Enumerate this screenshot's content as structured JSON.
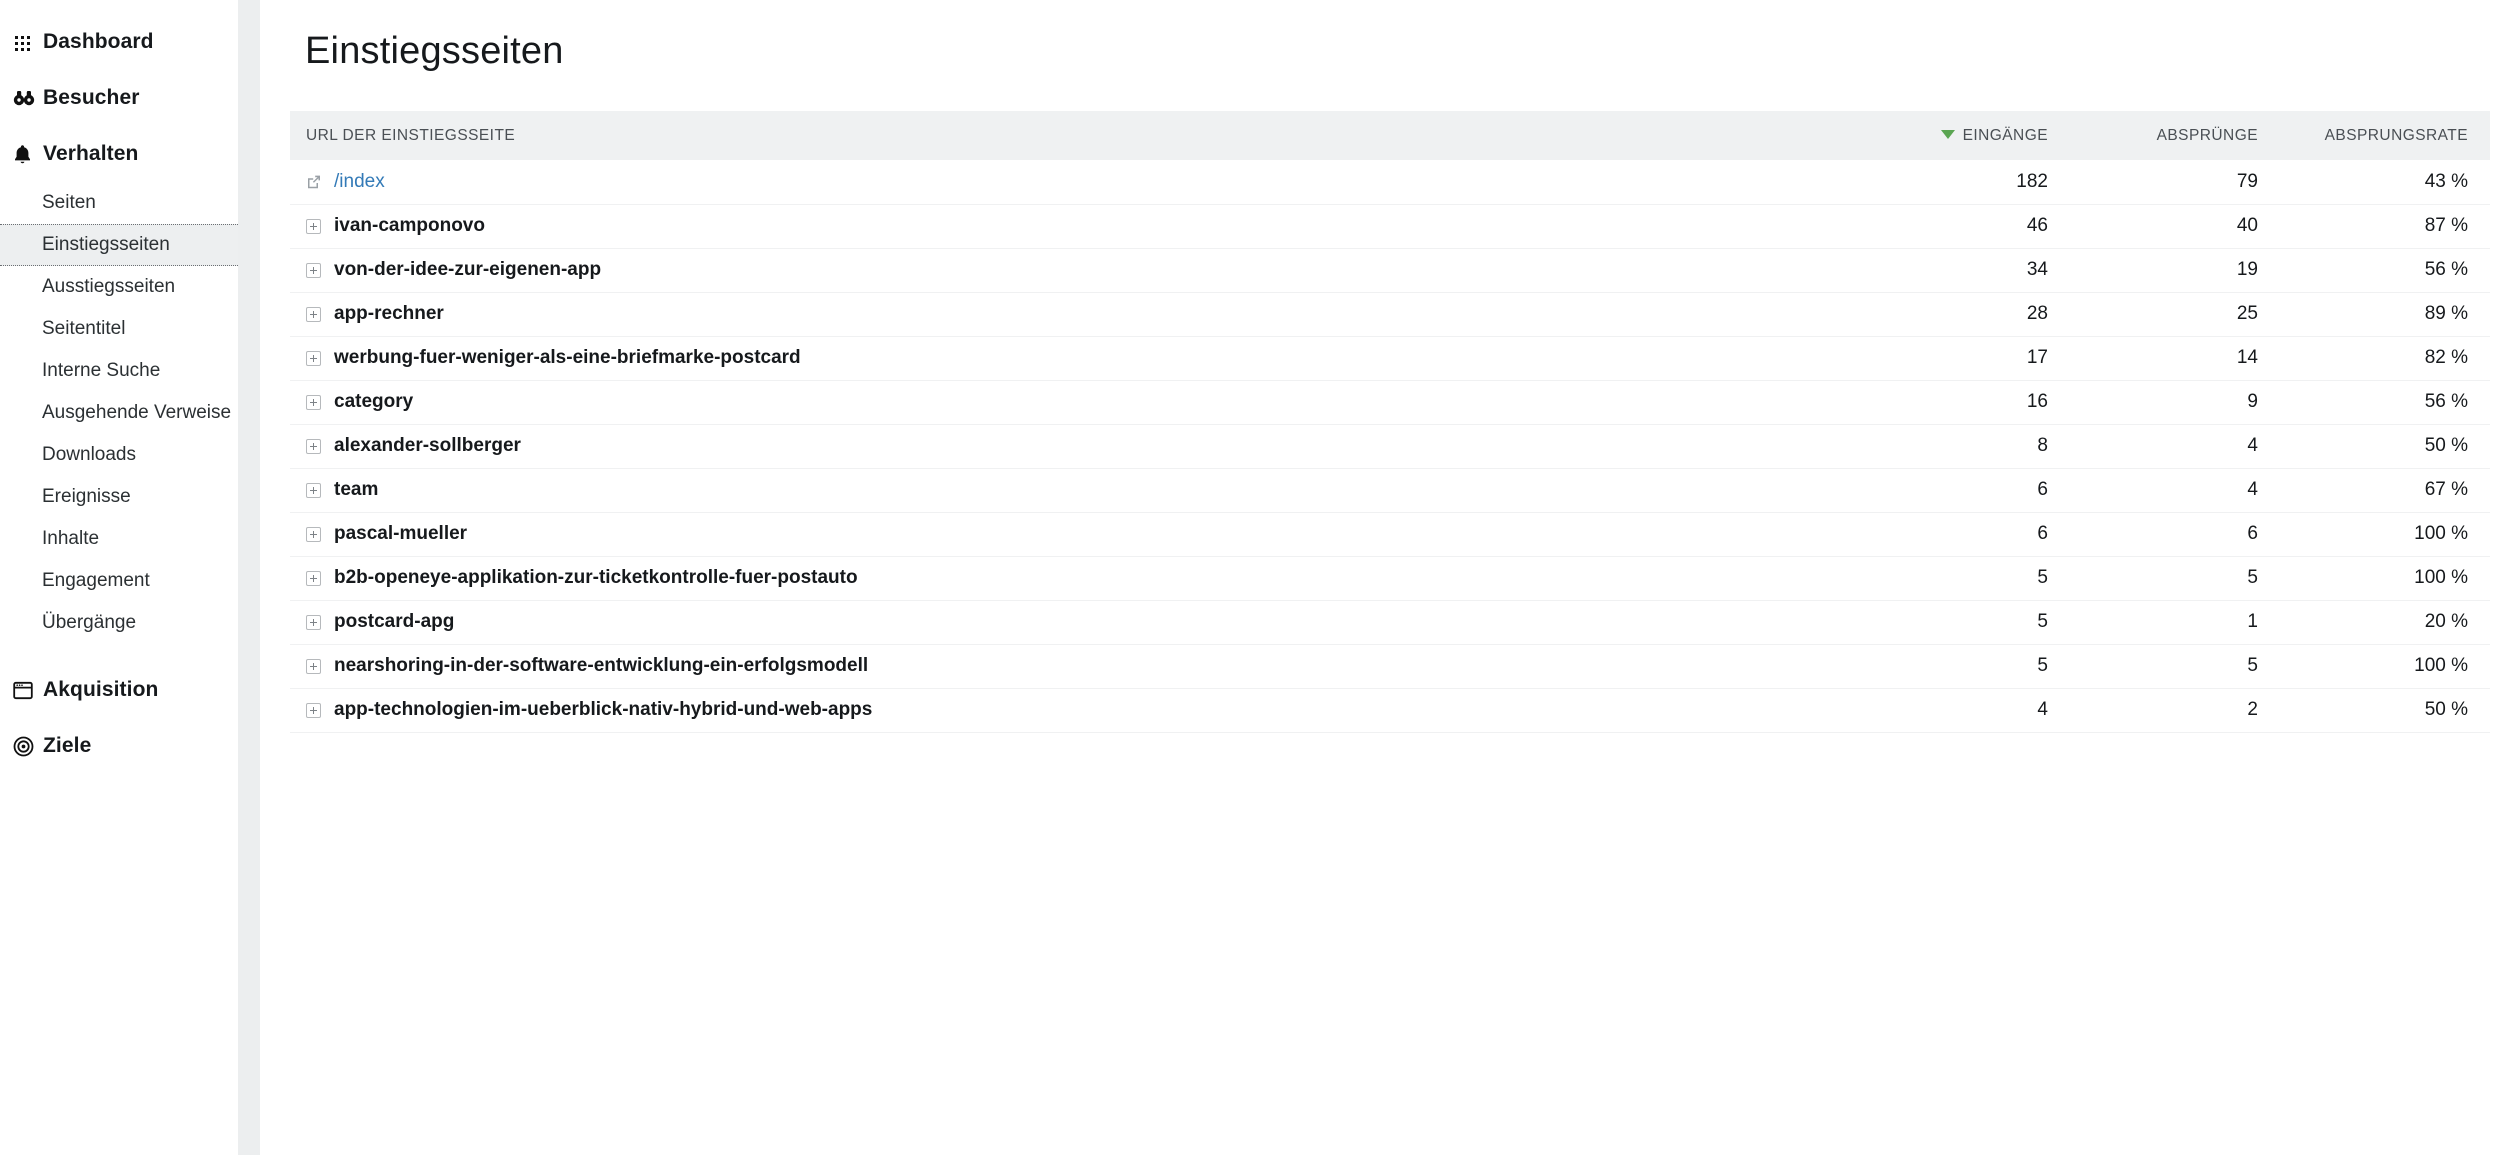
{
  "sidebar": {
    "items": [
      {
        "label": "Dashboard",
        "icon": "grid-icon",
        "level": "top",
        "active": false
      },
      {
        "label": "Besucher",
        "icon": "binoculars-icon",
        "level": "top",
        "active": false
      },
      {
        "label": "Verhalten",
        "icon": "bell-icon",
        "level": "top",
        "active": false
      },
      {
        "label": "Seiten",
        "icon": "",
        "level": "sub",
        "active": false
      },
      {
        "label": "Einstiegsseiten",
        "icon": "",
        "level": "sub",
        "active": true
      },
      {
        "label": "Ausstiegsseiten",
        "icon": "",
        "level": "sub",
        "active": false
      },
      {
        "label": "Seitentitel",
        "icon": "",
        "level": "sub",
        "active": false
      },
      {
        "label": "Interne Suche",
        "icon": "",
        "level": "sub",
        "active": false
      },
      {
        "label": "Ausgehende Verweise",
        "icon": "",
        "level": "sub",
        "active": false
      },
      {
        "label": "Downloads",
        "icon": "",
        "level": "sub",
        "active": false
      },
      {
        "label": "Ereignisse",
        "icon": "",
        "level": "sub",
        "active": false
      },
      {
        "label": "Inhalte",
        "icon": "",
        "level": "sub",
        "active": false
      },
      {
        "label": "Engagement",
        "icon": "",
        "level": "sub",
        "active": false
      },
      {
        "label": "Übergänge",
        "icon": "",
        "level": "sub",
        "active": false
      },
      {
        "label": "Akquisition",
        "icon": "window-icon",
        "level": "top",
        "active": false
      },
      {
        "label": "Ziele",
        "icon": "target-icon",
        "level": "top",
        "active": false
      }
    ]
  },
  "main": {
    "title": "Einstiegsseiten",
    "table": {
      "columns": [
        {
          "key": "url",
          "label": "URL DER EINSTIEGSSEITE",
          "align": "left",
          "sorted": false
        },
        {
          "key": "entries",
          "label": "EINGÄNGE",
          "align": "right",
          "sorted": true,
          "sort_dir": "desc"
        },
        {
          "key": "bounces",
          "label": "ABSPRÜNGE",
          "align": "right",
          "sorted": false
        },
        {
          "key": "bounce_rate",
          "label": "ABSPRUNGSRATE",
          "align": "right",
          "sorted": false
        }
      ],
      "sort_arrow_color": "#5aa552",
      "link_color": "#337ab7",
      "rows": [
        {
          "url": "/index",
          "icon": "external-link-icon",
          "is_link": true,
          "entries": "182",
          "bounces": "79",
          "bounce_rate": "43 %"
        },
        {
          "url": "ivan-camponovo",
          "icon": "expand-plus-icon",
          "is_link": false,
          "entries": "46",
          "bounces": "40",
          "bounce_rate": "87 %"
        },
        {
          "url": "von-der-idee-zur-eigenen-app",
          "icon": "expand-plus-icon",
          "is_link": false,
          "entries": "34",
          "bounces": "19",
          "bounce_rate": "56 %"
        },
        {
          "url": "app-rechner",
          "icon": "expand-plus-icon",
          "is_link": false,
          "entries": "28",
          "bounces": "25",
          "bounce_rate": "89 %"
        },
        {
          "url": "werbung-fuer-weniger-als-eine-briefmarke-postcard",
          "icon": "expand-plus-icon",
          "is_link": false,
          "entries": "17",
          "bounces": "14",
          "bounce_rate": "82 %"
        },
        {
          "url": "category",
          "icon": "expand-plus-icon",
          "is_link": false,
          "entries": "16",
          "bounces": "9",
          "bounce_rate": "56 %"
        },
        {
          "url": "alexander-sollberger",
          "icon": "expand-plus-icon",
          "is_link": false,
          "entries": "8",
          "bounces": "4",
          "bounce_rate": "50 %"
        },
        {
          "url": "team",
          "icon": "expand-plus-icon",
          "is_link": false,
          "entries": "6",
          "bounces": "4",
          "bounce_rate": "67 %"
        },
        {
          "url": "pascal-mueller",
          "icon": "expand-plus-icon",
          "is_link": false,
          "entries": "6",
          "bounces": "6",
          "bounce_rate": "100 %"
        },
        {
          "url": "b2b-openeye-applikation-zur-ticketkontrolle-fuer-postauto",
          "icon": "expand-plus-icon",
          "is_link": false,
          "entries": "5",
          "bounces": "5",
          "bounce_rate": "100 %"
        },
        {
          "url": "postcard-apg",
          "icon": "expand-plus-icon",
          "is_link": false,
          "entries": "5",
          "bounces": "1",
          "bounce_rate": "20 %"
        },
        {
          "url": "nearshoring-in-der-software-entwicklung-ein-erfolgsmodell",
          "icon": "expand-plus-icon",
          "is_link": false,
          "entries": "5",
          "bounces": "5",
          "bounce_rate": "100 %"
        },
        {
          "url": "app-technologien-im-ueberblick-nativ-hybrid-und-web-apps",
          "icon": "expand-plus-icon",
          "is_link": false,
          "entries": "4",
          "bounces": "2",
          "bounce_rate": "50 %"
        }
      ]
    }
  }
}
